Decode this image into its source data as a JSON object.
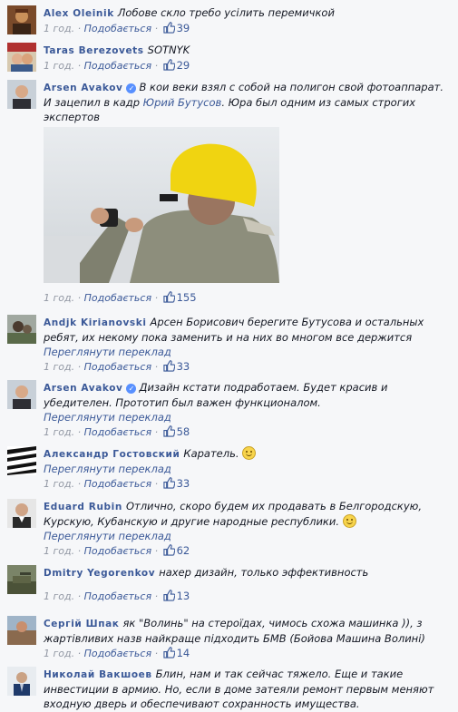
{
  "ui": {
    "like_label": "Подобається",
    "time": "1 год.",
    "translate_label": "Переглянути переклад",
    "dot": "·"
  },
  "comments": [
    {
      "author": "Alex Oleinik",
      "text": "Лобове скло требо усілить перемичкой",
      "likes": "39"
    },
    {
      "author": "Taras Berezovets",
      "text": "SOTNYK",
      "likes": "29"
    },
    {
      "author": "Arsen Avakov",
      "text_before": "В кои веки взял с собой на полигон свой фотоаппарат. И зацепил в кадр ",
      "mention": "Юрий Бутусов",
      "text_after": ". Юра был одним из самых строгих экспертов",
      "likes": "155"
    },
    {
      "author": "Andjk Kirianovski",
      "text": "Арсен Борисович берегите Бутусова и остальных ребят, их некому пока заменить и на них во многом все держится",
      "likes": "33"
    },
    {
      "author": "Arsen Avakov",
      "text": "Дизайн кстати подработаем. Будет красив и убедителен. Прототип был важен функционалом.",
      "likes": "58"
    },
    {
      "author": "Александр Гостовский",
      "text": "Каратель.",
      "likes": "33"
    },
    {
      "author": "Eduard Rubin",
      "text": "Отлично, скоро будем их продавать в Белгородскую, Курскую, Кубанскую и другие народные республики.",
      "likes": "62"
    },
    {
      "author": "Dmitry Yegorenkov",
      "text": "нахер дизайн, только эффективность",
      "likes": "13"
    },
    {
      "author": "Сергій Шпак",
      "text": "як \"Волинь\" на стероїдах, чимось схожа машинка )), з жартівливих назв найкраще підходить БМВ (Бойова Машина Волині)",
      "likes": "14"
    },
    {
      "author": "Николай Вакшоев",
      "text": "Блин, нам и так сейчас тяжело. Еще и такие инвестиции в армию. Но, если в доме затеяли ремонт первым меняют входную дверь и обеспечивают сохранность имущества."
    }
  ],
  "colors": {
    "link": "#3b5998",
    "meta": "#9197a3",
    "text": "#141823",
    "background": "#f6f7f9"
  },
  "icons": {
    "like": "thumbs-up-icon",
    "verified": "verified-badge-icon",
    "emoji": "smiley-emoji-icon"
  }
}
